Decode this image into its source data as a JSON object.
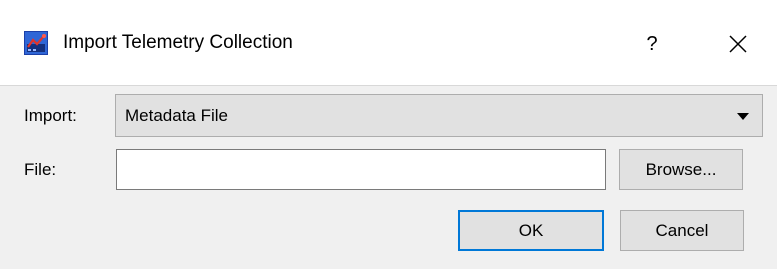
{
  "window": {
    "title": "Import Telemetry Collection",
    "help_label": "?",
    "app_icon": "telemetry-app-icon",
    "close_icon": "close-icon"
  },
  "form": {
    "import_label": "Import:",
    "import_value": "Metadata File",
    "file_label": "File:",
    "file_value": "",
    "browse_label": "Browse..."
  },
  "buttons": {
    "ok_label": "OK",
    "cancel_label": "Cancel"
  },
  "colors": {
    "dialog_background": "#f0f0f0",
    "titlebar_background": "#ffffff",
    "default_button_border": "#0078d7"
  }
}
